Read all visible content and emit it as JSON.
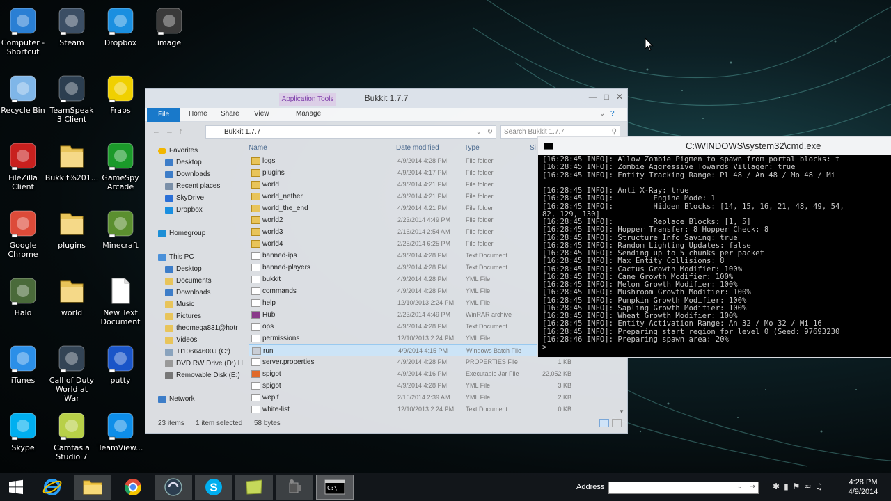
{
  "desktop": {
    "icons": [
      {
        "label": "Computer - Shortcut",
        "color": "#2a7fd4"
      },
      {
        "label": "Steam",
        "color": "#3b4e64"
      },
      {
        "label": "Dropbox",
        "color": "#1a8fe0"
      },
      {
        "label": "image",
        "color": "#3a3a3a"
      },
      {
        "label": "Recycle Bin",
        "color": "#7fb6e8"
      },
      {
        "label": "TeamSpeak 3 Client",
        "color": "#2c3e50"
      },
      {
        "label": "Fraps",
        "color": "#f0d000"
      },
      {
        "label": "FileZilla Client",
        "color": "#c8201e"
      },
      {
        "label": "Bukkit%201...",
        "color": "#e8c45a"
      },
      {
        "label": "GameSpy Arcade",
        "color": "#1b9a2a"
      },
      {
        "label": "Google Chrome",
        "color": "#dd4b39"
      },
      {
        "label": "plugins",
        "color": "#e8c45a"
      },
      {
        "label": "Minecraft",
        "color": "#5b8f2f"
      },
      {
        "label": "Halo",
        "color": "#4a6a3a"
      },
      {
        "label": "world",
        "color": "#e8c45a"
      },
      {
        "label": "New Text Document",
        "color": "#ffffff"
      },
      {
        "label": "iTunes",
        "color": "#2b8fe8"
      },
      {
        "label": "Call of Duty World at War",
        "color": "#334455"
      },
      {
        "label": "putty",
        "color": "#1a55c8"
      },
      {
        "label": "Skype",
        "color": "#00aff0"
      },
      {
        "label": "Camtasia Studio 7",
        "color": "#b8d048"
      },
      {
        "label": "TeamView...",
        "color": "#0e8ee9"
      }
    ]
  },
  "explorer": {
    "title": "Bukkit 1.7.7",
    "app_tools": "Application Tools",
    "ribbon_tabs": [
      "File",
      "Home",
      "Share",
      "View",
      "Manage"
    ],
    "address_path": "Bukkit 1.7.7",
    "search_placeholder": "Search Bukkit 1.7.7",
    "nav": [
      {
        "label": "Favorites",
        "indent": 0,
        "icon": "star-icon"
      },
      {
        "label": "Desktop",
        "indent": 1,
        "icon": "desktop-icon"
      },
      {
        "label": "Downloads",
        "indent": 1,
        "icon": "downloads-icon"
      },
      {
        "label": "Recent places",
        "indent": 1,
        "icon": "recent-icon"
      },
      {
        "label": "SkyDrive",
        "indent": 1,
        "icon": "cloud-icon"
      },
      {
        "label": "Dropbox",
        "indent": 1,
        "icon": "dropbox-icon"
      },
      {
        "label": "",
        "indent": 0,
        "icon": ""
      },
      {
        "label": "Homegroup",
        "indent": 0,
        "icon": "homegroup-icon"
      },
      {
        "label": "",
        "indent": 0,
        "icon": ""
      },
      {
        "label": "This PC",
        "indent": 0,
        "icon": "computer-icon"
      },
      {
        "label": "Desktop",
        "indent": 1,
        "icon": "desktop-icon"
      },
      {
        "label": "Documents",
        "indent": 1,
        "icon": "folder-icon"
      },
      {
        "label": "Downloads",
        "indent": 1,
        "icon": "downloads-icon"
      },
      {
        "label": "Music",
        "indent": 1,
        "icon": "music-icon"
      },
      {
        "label": "Pictures",
        "indent": 1,
        "icon": "pictures-icon"
      },
      {
        "label": "theomega831@hotr",
        "indent": 1,
        "icon": "folder-icon"
      },
      {
        "label": "Videos",
        "indent": 1,
        "icon": "videos-icon"
      },
      {
        "label": "TI10664600J (C:)",
        "indent": 1,
        "icon": "drive-icon"
      },
      {
        "label": "DVD RW Drive (D:) H",
        "indent": 1,
        "icon": "dvd-icon"
      },
      {
        "label": "Removable Disk (E:)",
        "indent": 1,
        "icon": "usb-drive-icon"
      },
      {
        "label": "",
        "indent": 0,
        "icon": ""
      },
      {
        "label": "Network",
        "indent": 0,
        "icon": "network-icon"
      }
    ],
    "columns": [
      "Name",
      "Date modified",
      "Type",
      "Si"
    ],
    "files": [
      {
        "name": "logs",
        "date": "4/9/2014 4:28 PM",
        "type": "File folder",
        "size": "",
        "kind": "folder"
      },
      {
        "name": "plugins",
        "date": "4/9/2014 4:17 PM",
        "type": "File folder",
        "size": "",
        "kind": "folder"
      },
      {
        "name": "world",
        "date": "4/9/2014 4:21 PM",
        "type": "File folder",
        "size": "",
        "kind": "folder"
      },
      {
        "name": "world_nether",
        "date": "4/9/2014 4:21 PM",
        "type": "File folder",
        "size": "",
        "kind": "folder"
      },
      {
        "name": "world_the_end",
        "date": "4/9/2014 4:21 PM",
        "type": "File folder",
        "size": "",
        "kind": "folder"
      },
      {
        "name": "world2",
        "date": "2/23/2014 4:49 PM",
        "type": "File folder",
        "size": "",
        "kind": "folder"
      },
      {
        "name": "world3",
        "date": "2/16/2014 2:54 AM",
        "type": "File folder",
        "size": "",
        "kind": "folder"
      },
      {
        "name": "world4",
        "date": "2/25/2014 6:25 PM",
        "type": "File folder",
        "size": "",
        "kind": "folder"
      },
      {
        "name": "banned-ips",
        "date": "4/9/2014 4:28 PM",
        "type": "Text Document",
        "size": "",
        "kind": "text"
      },
      {
        "name": "banned-players",
        "date": "4/9/2014 4:28 PM",
        "type": "Text Document",
        "size": "",
        "kind": "text"
      },
      {
        "name": "bukkit",
        "date": "4/9/2014 4:28 PM",
        "type": "YML File",
        "size": "",
        "kind": "file"
      },
      {
        "name": "commands",
        "date": "4/9/2014 4:28 PM",
        "type": "YML File",
        "size": "",
        "kind": "file"
      },
      {
        "name": "help",
        "date": "12/10/2013 2:24 PM",
        "type": "YML File",
        "size": "",
        "kind": "file"
      },
      {
        "name": "Hub",
        "date": "2/23/2014 4:49 PM",
        "type": "WinRAR archive",
        "size": "",
        "kind": "rar"
      },
      {
        "name": "ops",
        "date": "4/9/2014 4:28 PM",
        "type": "Text Document",
        "size": "",
        "kind": "text"
      },
      {
        "name": "permissions",
        "date": "12/10/2013 2:24 PM",
        "type": "YML File",
        "size": "",
        "kind": "file"
      },
      {
        "name": "run",
        "date": "4/9/2014 4:15 PM",
        "type": "Windows Batch File",
        "size": "",
        "kind": "batch"
      },
      {
        "name": "server.properties",
        "date": "4/9/2014 4:28 PM",
        "type": "PROPERTIES File",
        "size": "1 KB",
        "kind": "file"
      },
      {
        "name": "spigot",
        "date": "4/9/2014 4:16 PM",
        "type": "Executable Jar File",
        "size": "22,052 KB",
        "kind": "jar"
      },
      {
        "name": "spigot",
        "date": "4/9/2014 4:28 PM",
        "type": "YML File",
        "size": "3 KB",
        "kind": "file"
      },
      {
        "name": "wepif",
        "date": "2/16/2014 2:39 AM",
        "type": "YML File",
        "size": "2 KB",
        "kind": "file"
      },
      {
        "name": "white-list",
        "date": "12/10/2013 2:24 PM",
        "type": "Text Document",
        "size": "0 KB",
        "kind": "text"
      }
    ],
    "selected_index": 16,
    "status": {
      "items": "23 items",
      "selected": "1 item selected",
      "size": "58 bytes"
    }
  },
  "cmd": {
    "title": "C:\\WINDOWS\\system32\\cmd.exe",
    "lines": [
      "[16:28:45 INFO]: Allow Zombie Pigmen to spawn from portal blocks: t",
      "[16:28:45 INFO]: Zombie Aggressive Towards Villager: true",
      "[16:28:45 INFO]: Entity Tracking Range: Pl 48 / An 48 / Mo 48 / Mi",
      "",
      "[16:28:45 INFO]: Anti X-Ray: true",
      "[16:28:45 INFO]:         Engine Mode: 1",
      "[16:28:45 INFO]:         Hidden Blocks: [14, 15, 16, 21, 48, 49, 54,",
      "82, 129, 130]",
      "[16:28:45 INFO]:         Replace Blocks: [1, 5]",
      "[16:28:45 INFO]: Hopper Transfer: 8 Hopper Check: 8",
      "[16:28:45 INFO]: Structure Info Saving: true",
      "[16:28:45 INFO]: Random Lighting Updates: false",
      "[16:28:45 INFO]: Sending up to 5 chunks per packet",
      "[16:28:45 INFO]: Max Entity Collisions: 8",
      "[16:28:45 INFO]: Cactus Growth Modifier: 100%",
      "[16:28:45 INFO]: Cane Growth Modifier: 100%",
      "[16:28:45 INFO]: Melon Growth Modifier: 100%",
      "[16:28:45 INFO]: Mushroom Growth Modifier: 100%",
      "[16:28:45 INFO]: Pumpkin Growth Modifier: 100%",
      "[16:28:45 INFO]: Sapling Growth Modifier: 100%",
      "[16:28:45 INFO]: Wheat Growth Modifier: 100%",
      "[16:28:45 INFO]: Entity Activation Range: An 32 / Mo 32 / Mi 16",
      "[16:28:45 INFO]: Preparing start region for level 0 (Seed: 97693230",
      "[16:28:46 INFO]: Preparing spawn area: 20%",
      ">"
    ]
  },
  "taskbar": {
    "address_label": "Address",
    "time": "4:28 PM",
    "date": "4/9/2014"
  }
}
